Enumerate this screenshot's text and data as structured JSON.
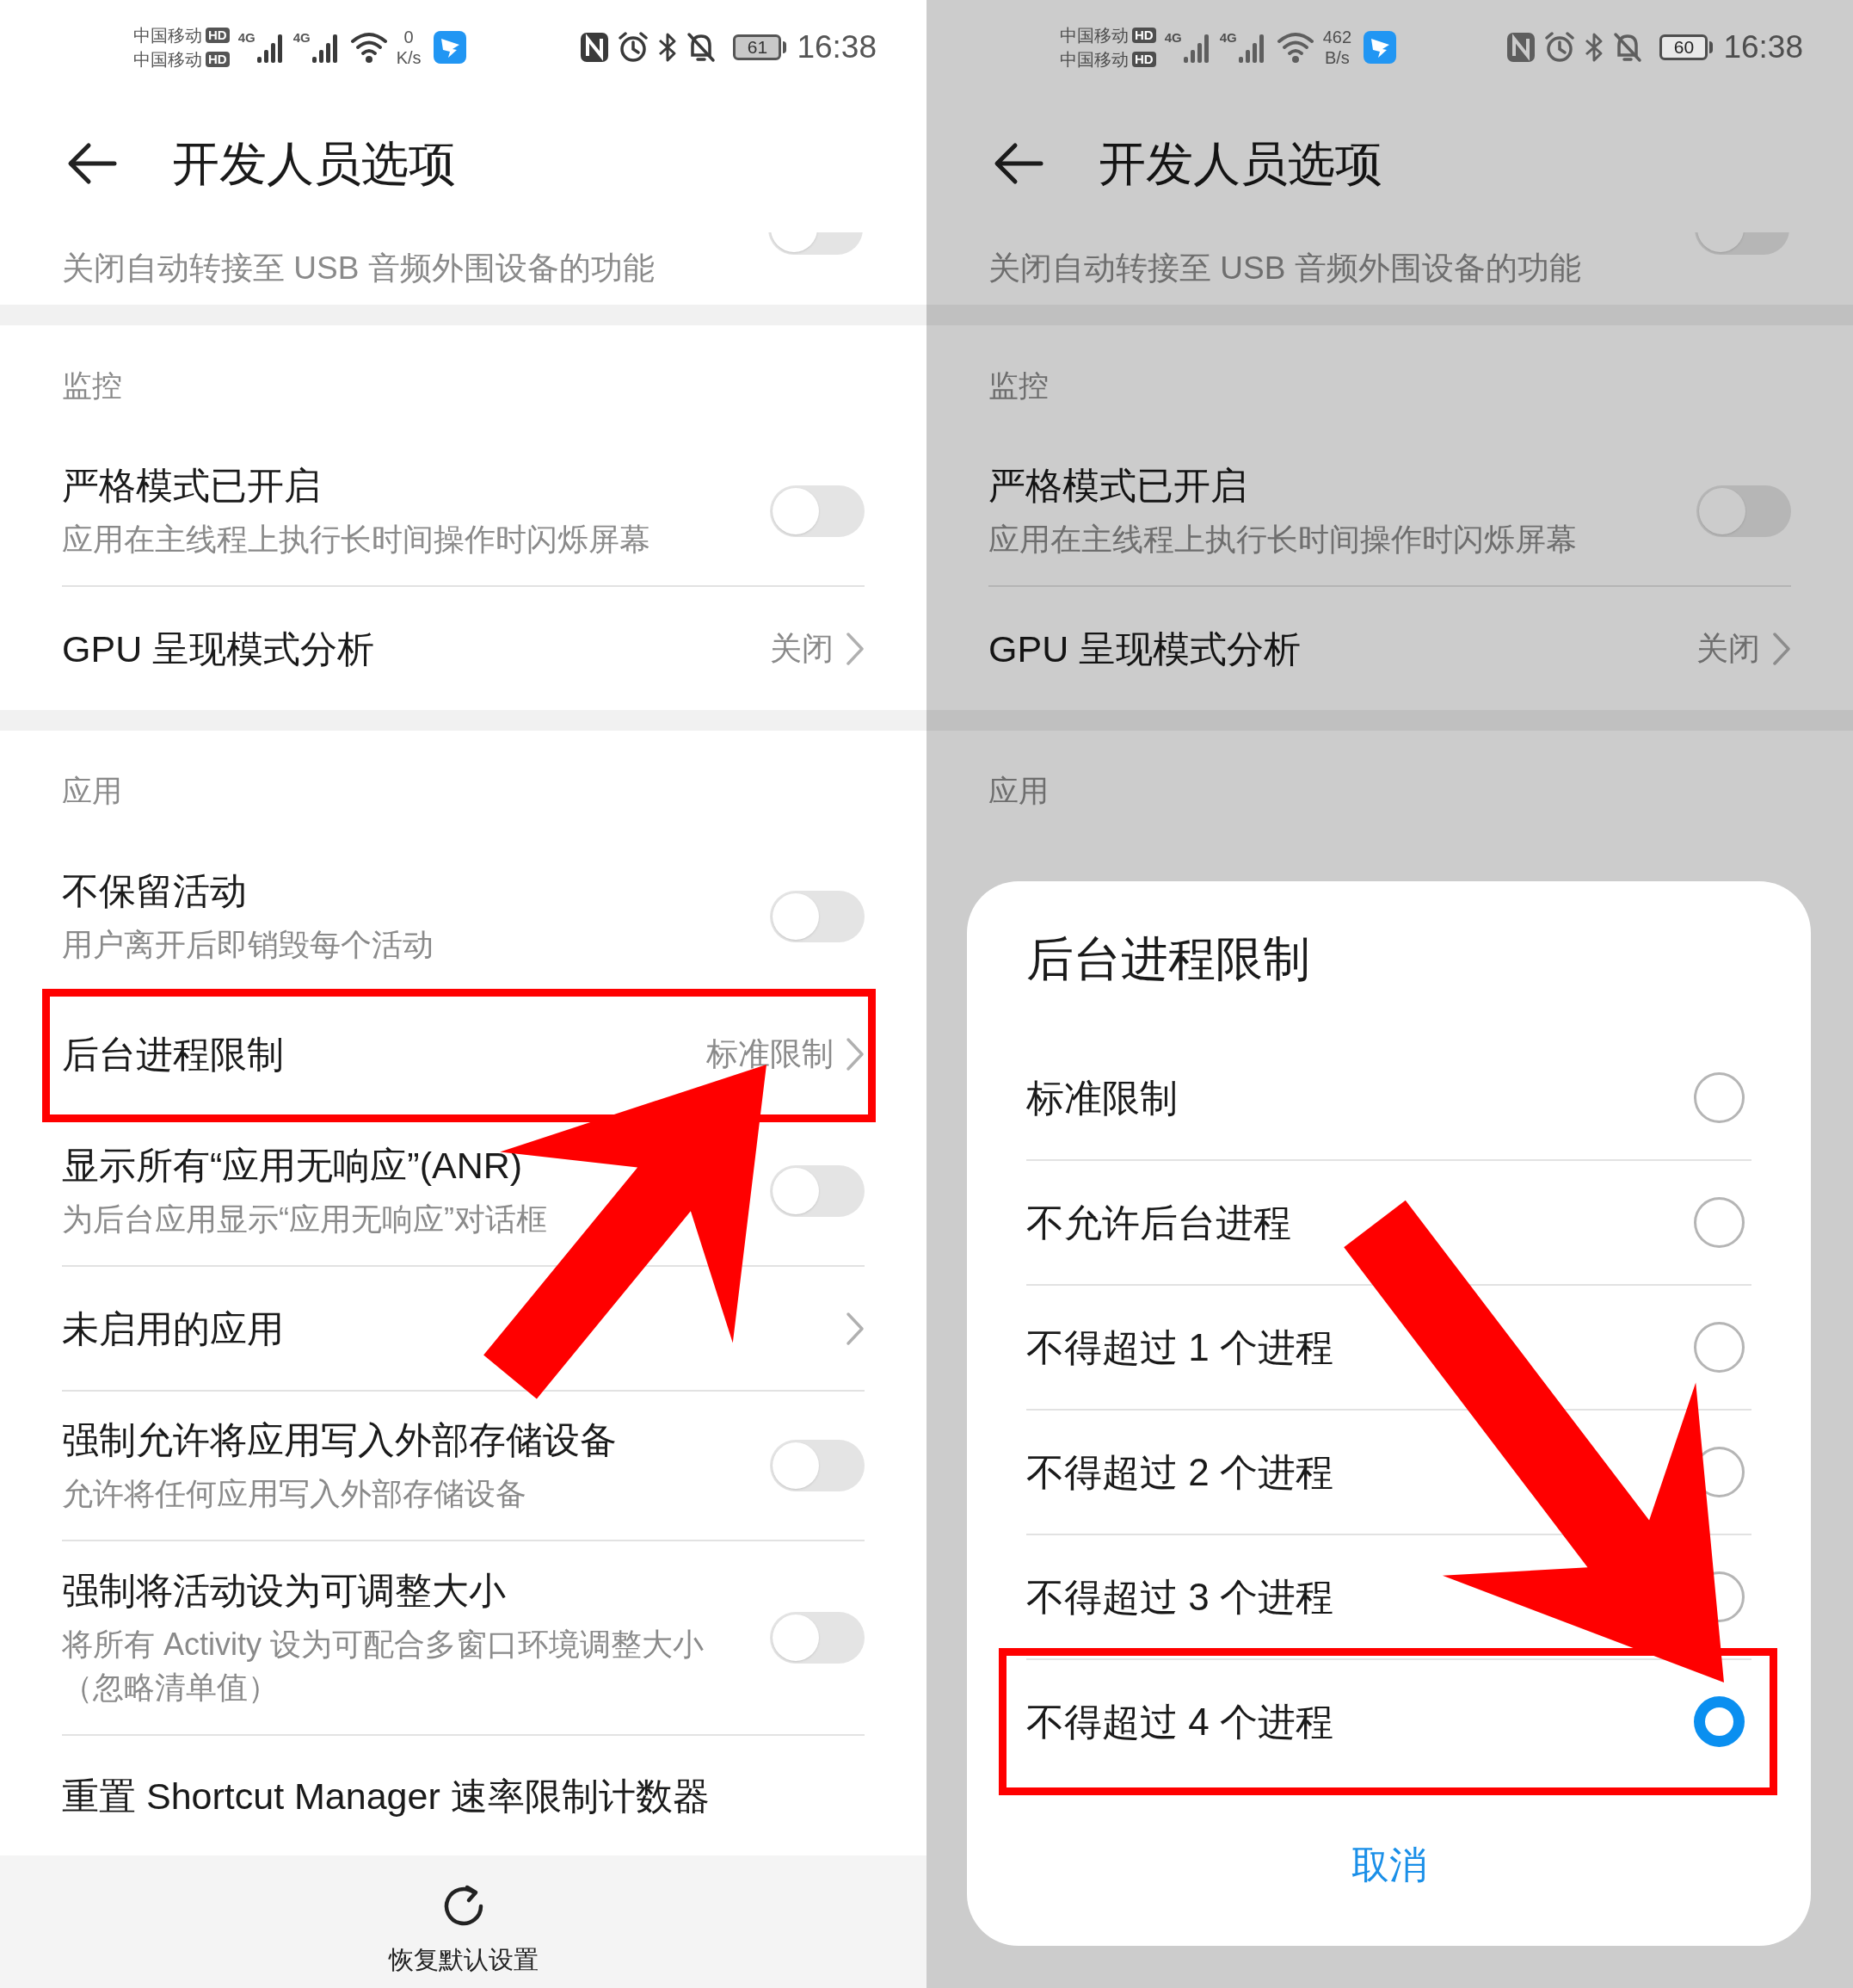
{
  "left_screen": {
    "status_bar": {
      "carrier_1": "中国移动",
      "carrier_2": "中国移动",
      "hd_1": "HD",
      "hd_2": "HD",
      "network_1": "4G",
      "network_2": "4G",
      "speed_value": "0",
      "speed_unit": "K/s",
      "battery": "61",
      "time": "16:38"
    },
    "title": "开发人员选项",
    "items": [
      {
        "kind": "cut_row",
        "title": "关闭自动转接至 USB 音频外围设备的功能",
        "on": false
      },
      {
        "kind": "gap"
      },
      {
        "kind": "section",
        "title": "监控"
      },
      {
        "kind": "toggle",
        "title": "严格模式已开启",
        "subtitle": "应用在主线程上执行长时间操作时闪烁屏幕",
        "on": false
      },
      {
        "kind": "value",
        "title": "GPU 呈现模式分析",
        "value": "关闭"
      },
      {
        "kind": "gap"
      },
      {
        "kind": "section",
        "title": "应用"
      },
      {
        "kind": "toggle",
        "title": "不保留活动",
        "subtitle": "用户离开后即销毁每个活动",
        "on": false
      },
      {
        "kind": "value",
        "title": "后台进程限制",
        "value": "标准限制",
        "highlighted": true
      },
      {
        "kind": "toggle",
        "title": "显示所有“应用无响应”(ANR)",
        "subtitle": "为后台应用显示“应用无响应”对话框",
        "on": false
      },
      {
        "kind": "link",
        "title": "未启用的应用"
      },
      {
        "kind": "toggle",
        "title": "强制允许将应用写入外部存储设备",
        "subtitle": "允许将任何应用写入外部存储设备",
        "on": false
      },
      {
        "kind": "toggle",
        "title": "强制将活动设为可调整大小",
        "subtitle": "将所有 Activity 设为可配合多窗口环境调整大小（忽略清单值）",
        "on": false
      },
      {
        "kind": "action",
        "title": "重置 Shortcut Manager 速率限制计数器"
      }
    ],
    "footer": {
      "label": "恢复默认设置"
    }
  },
  "right_screen": {
    "dimmed": true,
    "status_bar": {
      "carrier_1": "中国移动",
      "carrier_2": "中国移动",
      "hd_1": "HD",
      "hd_2": "HD",
      "network_1": "4G",
      "network_2": "4G",
      "speed_value": "462",
      "speed_unit": "B/s",
      "battery": "60",
      "time": "16:38"
    },
    "title": "开发人员选项",
    "items": [
      {
        "kind": "cut_row",
        "title": "关闭自动转接至 USB 音频外围设备的功能",
        "on": false
      },
      {
        "kind": "gap"
      },
      {
        "kind": "section",
        "title": "监控"
      },
      {
        "kind": "toggle",
        "title": "严格模式已开启",
        "subtitle": "应用在主线程上执行长时间操作时闪烁屏幕",
        "on": false
      },
      {
        "kind": "value",
        "title": "GPU 呈现模式分析",
        "value": "关闭"
      },
      {
        "kind": "gap"
      },
      {
        "kind": "section",
        "title": "应用"
      }
    ],
    "dialog": {
      "title": "后台进程限制",
      "options": [
        {
          "label": "标准限制",
          "selected": false
        },
        {
          "label": "不允许后台进程",
          "selected": false
        },
        {
          "label": "不得超过 1 个进程",
          "selected": false
        },
        {
          "label": "不得超过 2 个进程",
          "selected": false
        },
        {
          "label": "不得超过 3 个进程",
          "selected": false
        },
        {
          "label": "不得超过 4 个进程",
          "selected": true,
          "highlighted": true
        }
      ],
      "cancel": "取消"
    }
  }
}
